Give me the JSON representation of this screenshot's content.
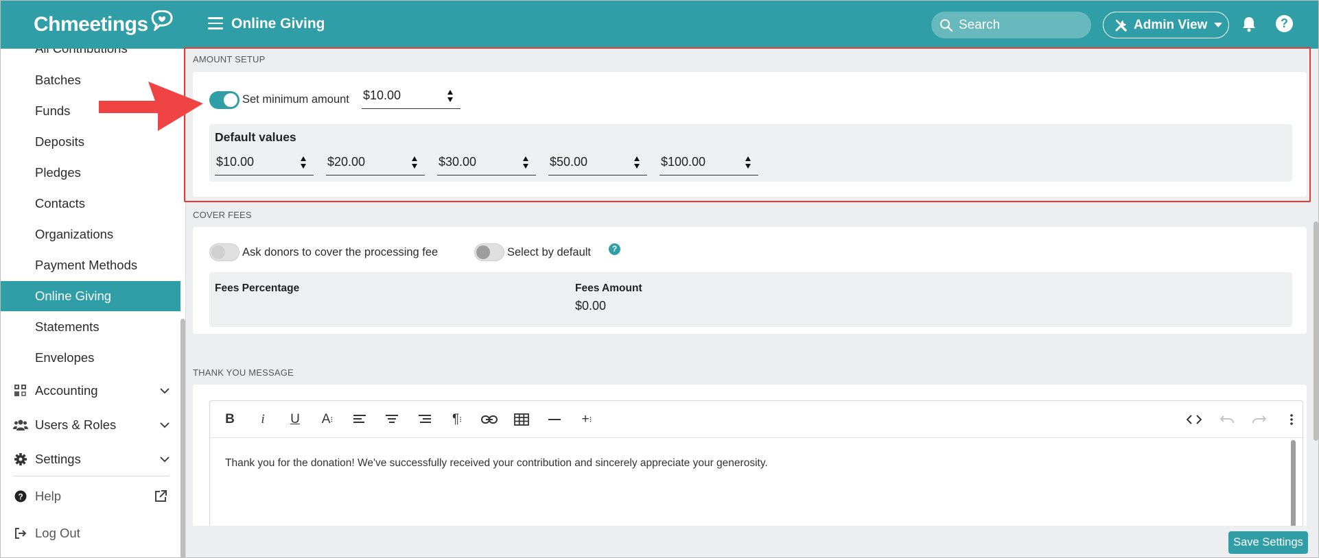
{
  "app": {
    "logo_text": "Chmeetings"
  },
  "header": {
    "title": "Online Giving",
    "search_placeholder": "Search",
    "admin_view_label": "Admin View"
  },
  "sidebar": {
    "items": [
      {
        "label": "All Contributions"
      },
      {
        "label": "Batches"
      },
      {
        "label": "Funds"
      },
      {
        "label": "Deposits"
      },
      {
        "label": "Pledges"
      },
      {
        "label": "Contacts"
      },
      {
        "label": "Organizations"
      },
      {
        "label": "Payment Methods"
      },
      {
        "label": "Online Giving",
        "active": true
      },
      {
        "label": "Statements"
      },
      {
        "label": "Envelopes"
      }
    ],
    "groups": [
      {
        "label": "Accounting",
        "icon": "accounting-icon"
      },
      {
        "label": "Users & Roles",
        "icon": "users-icon"
      },
      {
        "label": "Settings",
        "icon": "gear-icon"
      }
    ],
    "help_label": "Help",
    "logout_label": "Log Out"
  },
  "amount_setup": {
    "section_label": "AMOUNT SETUP",
    "min_toggle_on": true,
    "min_label": "Set minimum amount",
    "min_value": "$10.00",
    "default_values_title": "Default values",
    "default_values": [
      "$10.00",
      "$20.00",
      "$30.00",
      "$50.00",
      "$100.00"
    ]
  },
  "cover_fees": {
    "section_label": "COVER FEES",
    "ask_label": "Ask donors to cover the processing fee",
    "ask_on": false,
    "select_default_label": "Select by default",
    "select_default_on": false,
    "help_mark": "?",
    "fees_percentage_label": "Fees Percentage",
    "fees_amount_label": "Fees Amount",
    "fees_amount_value": "$0.00"
  },
  "thank_you": {
    "section_label": "THANK YOU MESSAGE",
    "toolbar_left": [
      "bold",
      "italic",
      "underline",
      "font-size",
      "align-left",
      "align-center",
      "align-right",
      "paragraph",
      "link",
      "table",
      "horizontal-rule",
      "insert"
    ],
    "toolbar_right": [
      "code-view",
      "undo",
      "redo",
      "more"
    ],
    "message": "Thank you for the donation! We've successfully received your contribution and sincerely appreciate your generosity."
  },
  "footer": {
    "save_label": "Save Settings"
  },
  "colors": {
    "brand": "#2f9ea6",
    "highlight": "#e53935",
    "arrow": "#f04444"
  }
}
